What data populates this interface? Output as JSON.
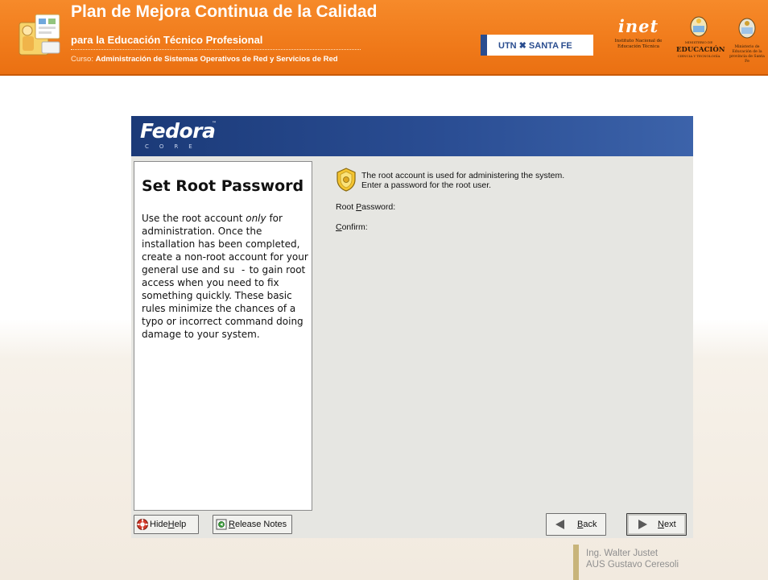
{
  "header": {
    "title": "Plan de Mejora Continua de la Calidad",
    "subtitle": "para la Educación Técnico Profesional",
    "course_prefix": "Curso:",
    "course_name": "Administración de Sistemas Operativos de Red y Servicios de Red",
    "utn_label": "UTN ✖ SANTA FE",
    "inet_word": "inet",
    "inet_caption": "Instituto Nacional de Educación Técnica",
    "education_word": "EDUCACIÓN",
    "education_top": "MINISTERIO DE",
    "education_bottom": "CIENCIA Y TECNOLOGÍA",
    "province_caption": "Ministerio de Educación de la provincia de Santa Fe"
  },
  "installer": {
    "brand": "Fedora",
    "brand_tm": "™",
    "brand_sub": "CORE",
    "help_title": "Set Root Password",
    "help_text_1": "Use the root account ",
    "help_text_only": "only",
    "help_text_2": " for administration. Once the installation has been completed, create a non-root account for your general use and ",
    "help_text_su": "su -",
    "help_text_3": " to gain root access when you need to fix something quickly. These basic rules minimize the chances of a typo or incorrect command doing damage to your system.",
    "intro_line1": "The root account is used for administering the system.",
    "intro_line2": "Enter a password for the root user.",
    "root_password_mnemonic": "P",
    "root_password_prefix": "Root ",
    "root_password_rest": "assword:",
    "confirm_mnemonic": "C",
    "confirm_rest": "onfirm:",
    "buttons": {
      "hide_help_prefix": "Hide ",
      "hide_help_mnemonic": "H",
      "hide_help_rest": "elp",
      "release_notes_mnemonic": "R",
      "release_notes_rest": "elease Notes",
      "back_mnemonic": "B",
      "back_rest": "ack",
      "next_mnemonic": "N",
      "next_rest": "ext"
    }
  },
  "footer": {
    "line1": "Ing. Walter Justet",
    "line2": "AUS Gustavo Ceresoli"
  },
  "colors": {
    "header_orange": "#f07a1a",
    "fedora_blue": "#2a4d93",
    "panel_gray": "#e6e6e2"
  }
}
